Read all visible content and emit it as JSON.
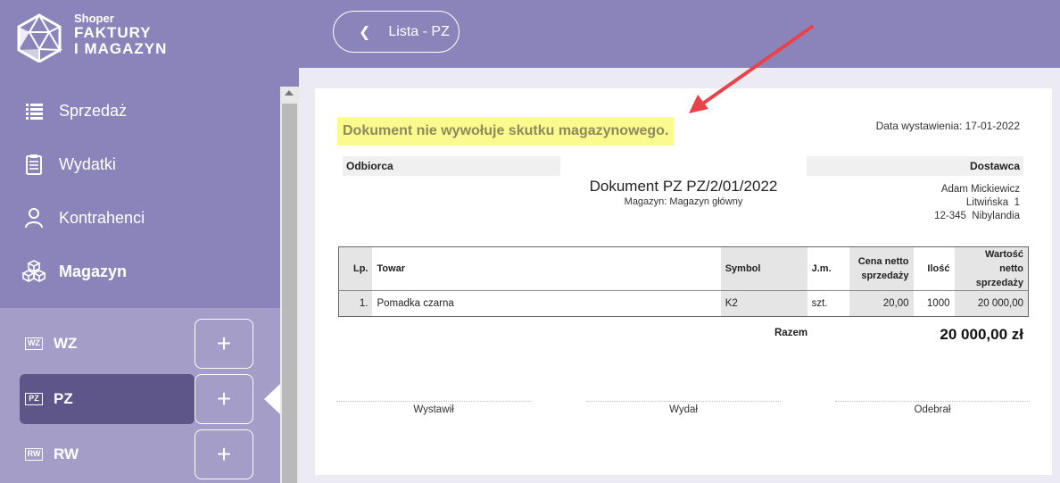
{
  "brand": {
    "small": "Shoper",
    "line1": "FAKTURY",
    "line2": "I MAGAZYN"
  },
  "nav": [
    {
      "label": "Sprzedaż",
      "icon": "list-icon"
    },
    {
      "label": "Wydatki",
      "icon": "clipboard-icon"
    },
    {
      "label": "Kontrahenci",
      "icon": "person-icon"
    },
    {
      "label": "Magazyn",
      "icon": "boxes-icon"
    }
  ],
  "subnav": [
    {
      "badge": "WZ",
      "label": "WZ",
      "plus": "+"
    },
    {
      "badge": "PZ",
      "label": "PZ",
      "plus": "+"
    },
    {
      "badge": "RW",
      "label": "RW",
      "plus": "+"
    }
  ],
  "topbar": {
    "back_label": "Lista - PZ",
    "back_icon": "chevron-left-icon"
  },
  "document": {
    "notice": "Dokument nie wywołuje skutku magazynowego.",
    "issue_date": "Data wystawienia: 17-01-2022",
    "recipient_label": "Odbiorca",
    "supplier_label": "Dostawca",
    "title": "Dokument PZ PZ/2/01/2022",
    "warehouse": "Magazyn: Magazyn główny",
    "supplier_name": "Adam Mickiewicz",
    "supplier_street": "Litwińska  1",
    "supplier_city": "12-345  Nibylandia",
    "columns": [
      "Lp.",
      "Towar",
      "Symbol",
      "J.m.",
      "Cena netto sprzedaży",
      "Ilość",
      "Wartość netto sprzedaży"
    ],
    "rows": [
      {
        "lp": "1.",
        "towar": "Pomadka czarna",
        "symbol": "K2",
        "jm": "szt.",
        "cena": "20,00",
        "ilosc": "1000",
        "wartosc": "20 000,00"
      }
    ],
    "total_label": "Razem",
    "total_value": "20 000,00 zł",
    "signatures": [
      "Wystawił",
      "Wydał",
      "Odebrał"
    ]
  },
  "colors": {
    "sidebar": "#8b84ba",
    "subnav": "#a39dc8",
    "active": "#5e5688",
    "highlight": "#fafa8e",
    "arrow": "#e8434a"
  }
}
